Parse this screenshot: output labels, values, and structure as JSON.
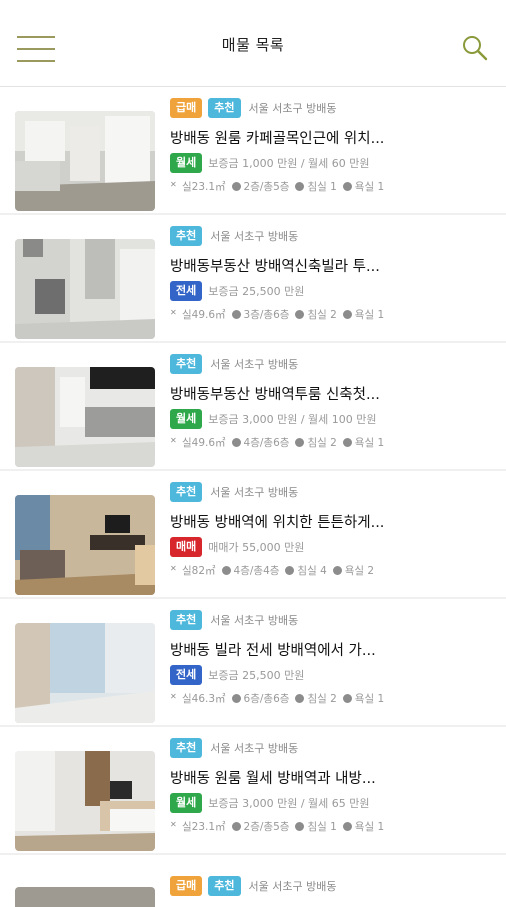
{
  "header": {
    "title": "매물 목록",
    "menu_icon": "hamburger-menu-icon",
    "search_icon": "search-icon"
  },
  "colors": {
    "urgent": "#f0a33a",
    "recommend": "#4db8dc",
    "monthly": "#2ea84a",
    "jeonse": "#3364c8",
    "sale": "#d8262d",
    "accent": "#8a9a3a"
  },
  "listings": [
    {
      "badges": [
        "급매",
        "추천"
      ],
      "location": "서울 서초구 방배동",
      "title": "방배동 원룸 카페골목인근에 위치...",
      "deal": "월세",
      "price": "보증금 1,000 만원 / 월세 60 만원",
      "area": "실23.1㎡",
      "floor": "2층/총5층",
      "rooms": "침실 1",
      "baths": "욕실 1"
    },
    {
      "badges": [
        "추천"
      ],
      "location": "서울 서초구 방배동",
      "title": "방배동부동산 방배역신축빌라 투...",
      "deal": "전세",
      "price": "보증금 25,500 만원",
      "area": "실49.6㎡",
      "floor": "3층/총6층",
      "rooms": "침실 2",
      "baths": "욕실 1"
    },
    {
      "badges": [
        "추천"
      ],
      "location": "서울 서초구 방배동",
      "title": "방배동부동산 방배역투룸 신축첫...",
      "deal": "월세",
      "price": "보증금 3,000 만원 / 월세 100 만원",
      "area": "실49.6㎡",
      "floor": "4층/총6층",
      "rooms": "침실 2",
      "baths": "욕실 1"
    },
    {
      "badges": [
        "추천"
      ],
      "location": "서울 서초구 방배동",
      "title": "방배동 방배역에 위치한 튼튼하게...",
      "deal": "매매",
      "price": "매매가 55,000 만원",
      "area": "실82㎡",
      "floor": "4층/총4층",
      "rooms": "침실 4",
      "baths": "욕실 2"
    },
    {
      "badges": [
        "추천"
      ],
      "location": "서울 서초구 방배동",
      "title": "방배동 빌라 전세 방배역에서 가...",
      "deal": "전세",
      "price": "보증금 25,500 만원",
      "area": "실46.3㎡",
      "floor": "6층/총6층",
      "rooms": "침실 2",
      "baths": "욕실 1"
    },
    {
      "badges": [
        "추천"
      ],
      "location": "서울 서초구 방배동",
      "title": "방배동 원룸 월세 방배역과 내방...",
      "deal": "월세",
      "price": "보증금 3,000 만원 / 월세 65 만원",
      "area": "실23.1㎡",
      "floor": "2층/총5층",
      "rooms": "침실 1",
      "baths": "욕실 1"
    }
  ],
  "partial": {
    "badges": [
      "급매",
      "추천"
    ],
    "location": "서울 서초구 방배동"
  }
}
